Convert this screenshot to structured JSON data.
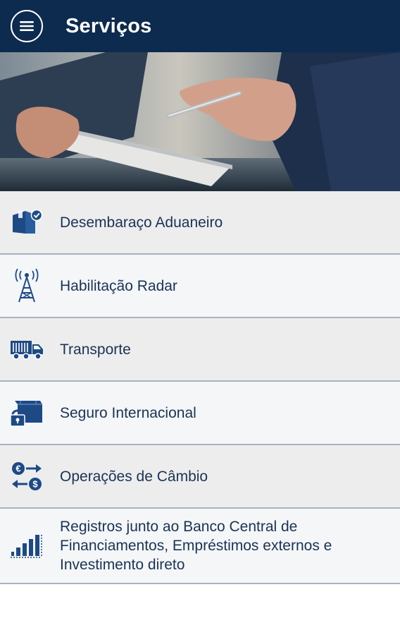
{
  "header": {
    "title": "Serviços",
    "menu_icon": "menu-icon"
  },
  "colors": {
    "topbar": "#0d2a4f",
    "icon": "#1d4a85",
    "text": "#1b3354",
    "divider": "#a9b2bf"
  },
  "services": [
    {
      "label": "Desembaraço Aduaneiro",
      "icon": "customs-box-check-icon"
    },
    {
      "label": "Habilitação Radar",
      "icon": "radar-antenna-icon"
    },
    {
      "label": "Transporte",
      "icon": "truck-icon"
    },
    {
      "label": "Seguro Internacional",
      "icon": "lock-insurance-icon"
    },
    {
      "label": "Operações de Câmbio",
      "icon": "currency-exchange-icon"
    },
    {
      "label": "Registros junto ao Banco Central de Financiamentos, Empréstimos externos e Investimento direto",
      "icon": "bar-chart-icon"
    }
  ]
}
